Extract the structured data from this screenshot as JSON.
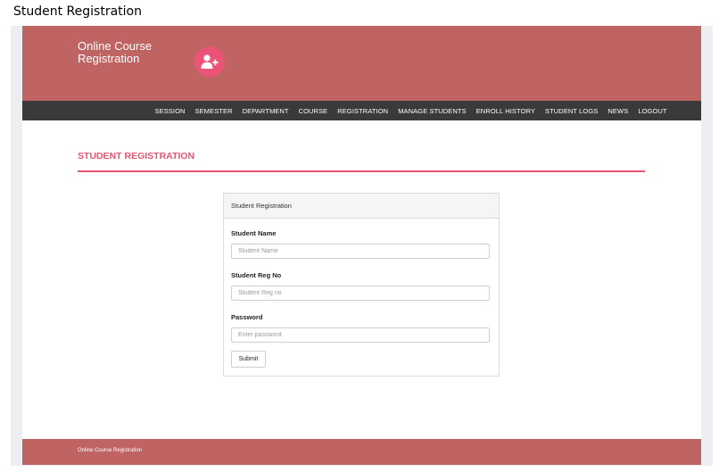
{
  "caption": "Student Registration",
  "header": {
    "brand_line1": "Online Course",
    "brand_line2": "Registration",
    "logo_icon": "user-plus-icon",
    "background_color": "#c06363",
    "logo_color": "#ec5477"
  },
  "nav": {
    "items": [
      "SESSION",
      "SEMESTER",
      "DEPARTMENT",
      "COURSE",
      "REGISTRATION",
      "MANAGE STUDENTS",
      "ENROLL HISTORY",
      "STUDENT LOGS",
      "NEWS",
      "LOGOUT"
    ],
    "background_color": "#3a3a3a"
  },
  "main": {
    "title": "STUDENT REGISTRATION",
    "accent_color": "#e8546e",
    "panel": {
      "heading": "Student Registration",
      "fields": {
        "name": {
          "label": "Student Name",
          "placeholder": "Student Name",
          "value": ""
        },
        "reg_no": {
          "label": "Student Reg No",
          "placeholder": "Student Reg no",
          "value": ""
        },
        "password": {
          "label": "Password",
          "placeholder": "Enter password",
          "value": ""
        }
      },
      "submit_label": "Submit"
    }
  },
  "footer": {
    "text": "Online Course Registration"
  }
}
